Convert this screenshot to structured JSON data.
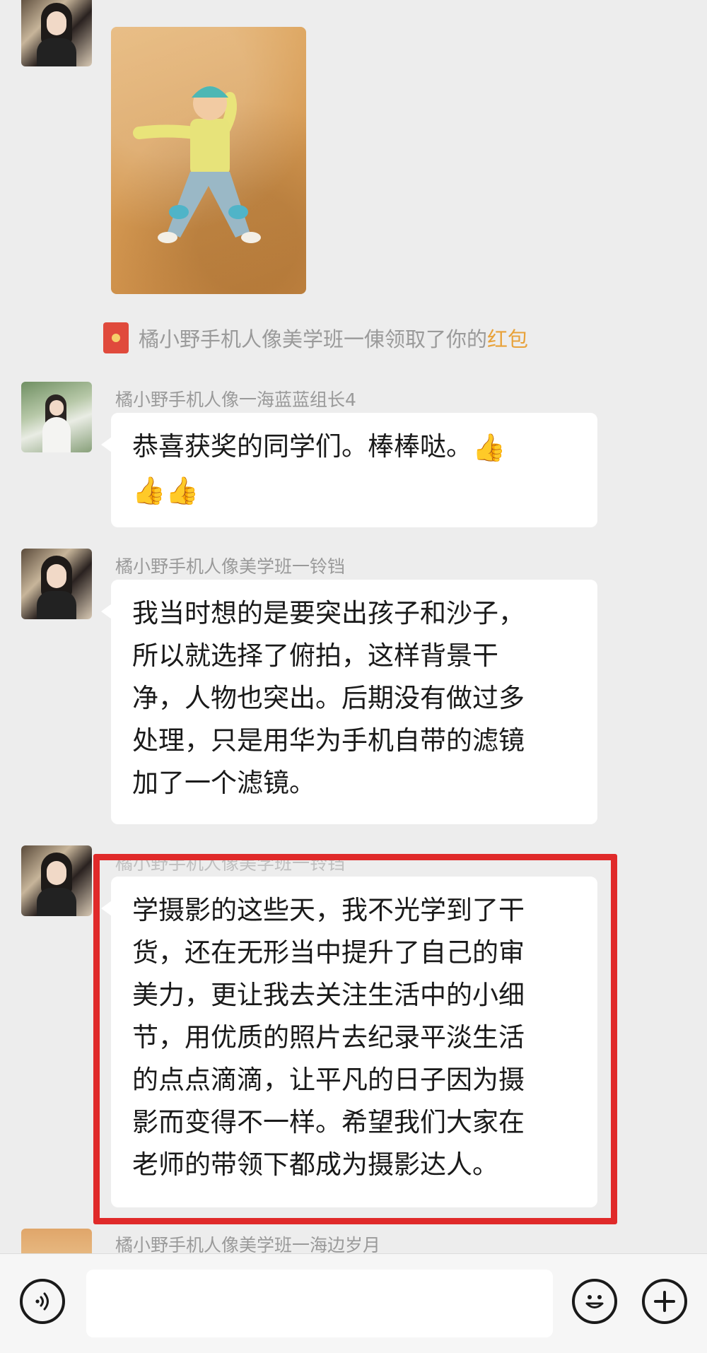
{
  "chat": {
    "system_note": {
      "text": "橘小野手机人像美学班一倲领取了你的",
      "link": "红包"
    },
    "messages": [
      {
        "sender": "橘小野手机人像一海蓝蓝组长4",
        "lines": [
          "恭喜获奖的同学们。棒棒哒。"
        ],
        "emoji": [
          "👍",
          "👍",
          "👍"
        ]
      },
      {
        "sender": "橘小野手机人像美学班一铃铛",
        "lines": [
          "我当时想的是要突出孩子和沙子，",
          "所以就选择了俯拍，这样背景干",
          "净，人物也突出。后期没有做过多",
          "处理，只是用华为手机自带的滤镜",
          "加了一个滤镜。"
        ]
      },
      {
        "sender": "橘小野手机人像美学班一铃铛",
        "lines": [
          "学摄影的这些天，我不光学到了干",
          "货，还在无形当中提升了自己的审",
          "美力，更让我去关注生活中的小细",
          "节，用优质的照片去纪录平淡生活",
          "的点点滴滴，让平凡的日子因为摄",
          "影而变得不一样。希望我们大家在",
          "老师的带领下都成为摄影达人。"
        ]
      },
      {
        "sender": "橘小野手机人像美学班一海边岁月"
      }
    ]
  },
  "input_bar": {
    "icons": [
      "voice-icon",
      "emoji-icon",
      "plus-icon"
    ],
    "value": ""
  },
  "colors": {
    "background": "#ededed",
    "bubble": "#ffffff",
    "highlight": "#e02a2a",
    "red_packet_link": "#e8a23a"
  }
}
